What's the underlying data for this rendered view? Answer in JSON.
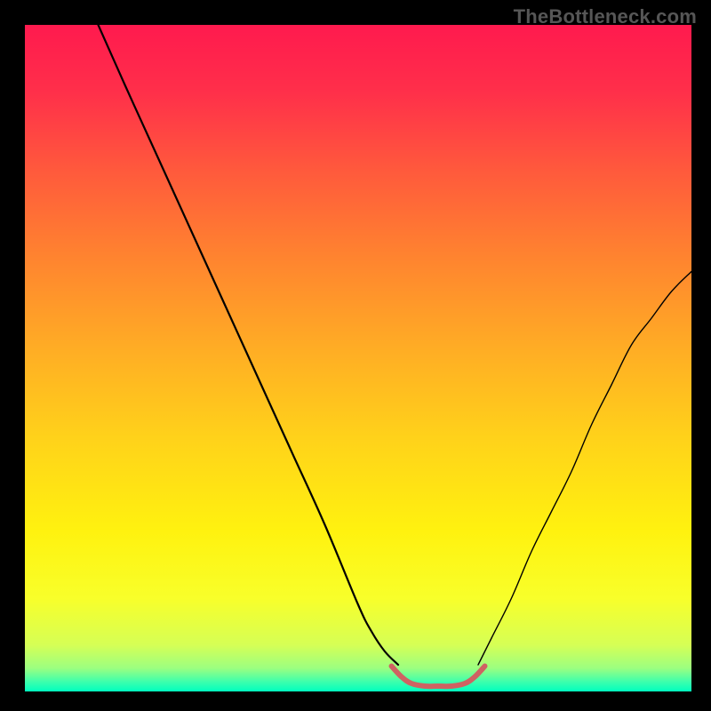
{
  "watermark": "TheBottleneck.com",
  "chart_data": {
    "type": "line",
    "title": "",
    "xlabel": "",
    "ylabel": "",
    "xlim": [
      0,
      100
    ],
    "ylim": [
      0,
      100
    ],
    "grid": false,
    "legend": false,
    "series": [
      {
        "name": "left-curve",
        "stroke": "#000000",
        "stroke_width": 2.2,
        "x": [
          11,
          15,
          20,
          25,
          30,
          35,
          40,
          45,
          50,
          52,
          54,
          56
        ],
        "y": [
          100,
          91,
          80,
          69,
          58,
          47,
          36,
          25,
          13,
          9,
          6,
          4
        ]
      },
      {
        "name": "right-curve",
        "stroke": "#000000",
        "stroke_width": 1.4,
        "x": [
          68,
          70,
          73,
          76,
          79,
          82,
          85,
          88,
          91,
          94,
          97,
          100
        ],
        "y": [
          4,
          8,
          14,
          21,
          27,
          33,
          40,
          46,
          52,
          56,
          60,
          63
        ]
      },
      {
        "name": "trough",
        "stroke": "#cf6262",
        "stroke_width": 6,
        "x": [
          55,
          56.5,
          58,
          60,
          62,
          64,
          66,
          67.5,
          69
        ],
        "y": [
          3.8,
          2.2,
          1.2,
          0.8,
          0.8,
          0.8,
          1.2,
          2.2,
          3.8
        ]
      }
    ],
    "background_gradient": {
      "stops": [
        {
          "offset": 0.0,
          "color": "#ff1a4e"
        },
        {
          "offset": 0.1,
          "color": "#ff2f4a"
        },
        {
          "offset": 0.22,
          "color": "#ff5a3c"
        },
        {
          "offset": 0.35,
          "color": "#ff842f"
        },
        {
          "offset": 0.48,
          "color": "#ffab25"
        },
        {
          "offset": 0.62,
          "color": "#ffd21a"
        },
        {
          "offset": 0.76,
          "color": "#fff20f"
        },
        {
          "offset": 0.86,
          "color": "#f8ff2a"
        },
        {
          "offset": 0.93,
          "color": "#d6ff55"
        },
        {
          "offset": 0.965,
          "color": "#9cff80"
        },
        {
          "offset": 0.985,
          "color": "#3fffac"
        },
        {
          "offset": 1.0,
          "color": "#00ffbf"
        }
      ]
    }
  }
}
